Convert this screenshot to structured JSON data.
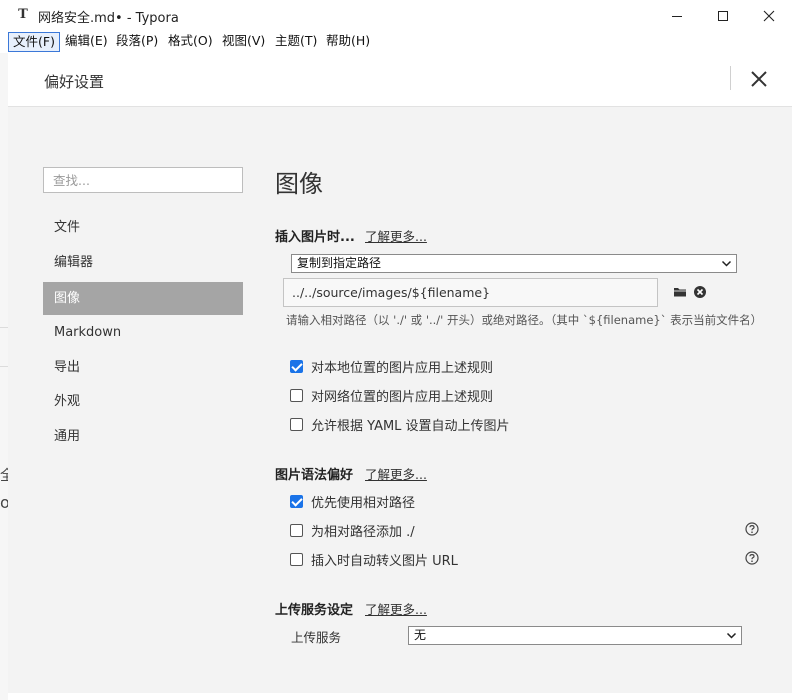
{
  "window": {
    "app_icon_letter": "T",
    "title": "网络安全.md• - Typora"
  },
  "menubar": [
    {
      "label": "文件(F)"
    },
    {
      "label": "编辑(E)"
    },
    {
      "label": "段落(P)"
    },
    {
      "label": "格式(O)"
    },
    {
      "label": "视图(V)"
    },
    {
      "label": "主题(T)"
    },
    {
      "label": "帮助(H)"
    }
  ],
  "background": {
    "char1": "全",
    "char2": "o"
  },
  "dialog": {
    "title": "偏好设置",
    "search_placeholder": "查找...",
    "nav": [
      {
        "label": "文件"
      },
      {
        "label": "编辑器"
      },
      {
        "label": "图像",
        "active": true
      },
      {
        "label": "Markdown"
      },
      {
        "label": "导出"
      },
      {
        "label": "外观"
      },
      {
        "label": "通用"
      }
    ],
    "section_title": "图像",
    "insert": {
      "label": "插入图片时...",
      "learn_more": "了解更多...",
      "action_selected": "复制到指定路径",
      "path_value": "../../source/images/${filename}",
      "hint": "请输入相对路径（以 './' 或 '../' 开头）或绝对路径。（其中 `${filename}` 表示当前文件名）",
      "options": [
        {
          "label": "对本地位置的图片应用上述规则",
          "checked": true
        },
        {
          "label": "对网络位置的图片应用上述规则",
          "checked": false
        },
        {
          "label": "允许根据 YAML 设置自动上传图片",
          "checked": false
        }
      ]
    },
    "syntax": {
      "label": "图片语法偏好",
      "learn_more": "了解更多...",
      "options": [
        {
          "label": "优先使用相对路径",
          "checked": true
        },
        {
          "label": "为相对路径添加 ./",
          "checked": false
        },
        {
          "label": "插入时自动转义图片 URL",
          "checked": false
        }
      ]
    },
    "upload": {
      "label": "上传服务设定",
      "learn_more": "了解更多...",
      "service_label": "上传服务",
      "service_selected": "无"
    }
  },
  "colors": {
    "accent": "#1a73e8",
    "nav_active_bg": "#a5a5a5",
    "dialog_bg": "#f3f3f3"
  }
}
